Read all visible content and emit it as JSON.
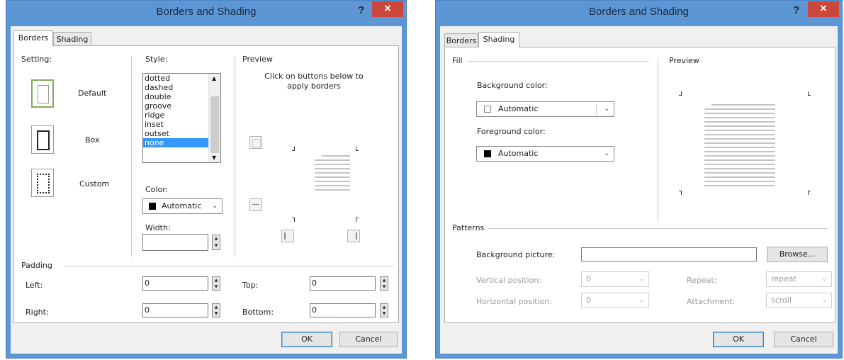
{
  "dialog1": {
    "title": "Borders and Shading",
    "help": "?",
    "close": "×",
    "tabs": [
      "Borders",
      "Shading"
    ],
    "setting_label": "Setting:",
    "settings": [
      "Default",
      "Box",
      "Custom"
    ],
    "style_label": "Style:",
    "styles": [
      "dotted",
      "dashed",
      "double",
      "groove",
      "ridge",
      "inset",
      "outset",
      "none"
    ],
    "selected_style": "none",
    "color_label": "Color:",
    "color_value": "Automatic",
    "width_label": "Width:",
    "width_value": "",
    "preview_label": "Preview",
    "preview_hint": "Click on buttons below to apply borders",
    "padding_label": "Padding",
    "left_label": "Left:",
    "left_value": "0",
    "right_label": "Right:",
    "right_value": "0",
    "top_label": "Top:",
    "top_value": "0",
    "bottom_label": "Bottom:",
    "bottom_value": "0",
    "ok": "OK",
    "cancel": "Cancel"
  },
  "dialog2": {
    "title": "Borders and Shading",
    "help": "?",
    "close": "×",
    "tabs": [
      "Borders",
      "Shading"
    ],
    "fill_label": "Fill",
    "bg_color_label": "Background color:",
    "bg_color_value": "Automatic",
    "fg_color_label": "Foreground color:",
    "fg_color_value": "Automatic",
    "preview_label": "Preview",
    "patterns_label": "Patterns",
    "bg_picture_label": "Background picture:",
    "bg_picture_value": "",
    "browse": "Browse...",
    "vpos_label": "Vertical position:",
    "vpos_value": "0",
    "hpos_label": "Horizontal position:",
    "hpos_value": "0",
    "repeat_label": "Repeat:",
    "repeat_value": "repeat",
    "attachment_label": "Attachment:",
    "attachment_value": "scroll",
    "ok": "OK",
    "cancel": "Cancel"
  },
  "colors": {
    "frame": "#5d96d4",
    "close": "#c9473b",
    "selection": "#3399ff"
  }
}
